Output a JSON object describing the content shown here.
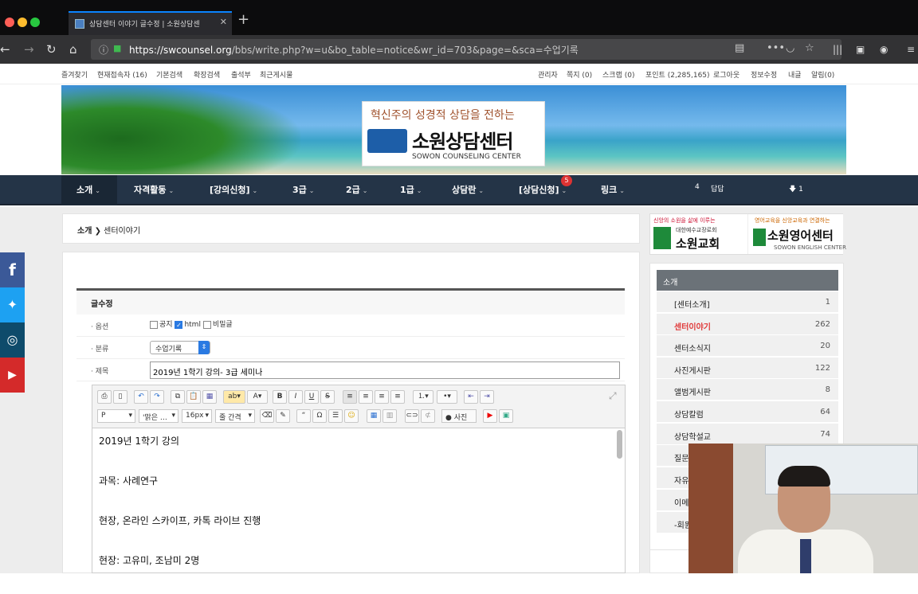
{
  "browser": {
    "tab_title": "상담센터 이야기 글수정 | 소원상담센",
    "url_host": "https://swcounsel.org",
    "url_path": "/bbs/write.php?w=u&bo_table=notice&wr_id=703&page=&sca=수업기록"
  },
  "toplinks": {
    "left": [
      "즐겨찾기",
      "현재접속자 (16)",
      "기본검색",
      "확장검색",
      "출석부",
      "최근게시물"
    ],
    "right": [
      "관리자",
      "쪽지 (0)",
      "스크랩 (0)",
      "포인트 (2,285,165)",
      "로그아웃",
      "정보수정",
      "내글",
      "알림(0)"
    ]
  },
  "banner": {
    "slogan": "혁신주의 성경적 상담을 전하는",
    "name": "소원상담센터",
    "name_en": "SOWON COUNSELING CENTER"
  },
  "menu": {
    "items": [
      "소개",
      "자격활동",
      "[강의신청]",
      "3급",
      "2급",
      "1급",
      "상담란",
      "[상담신청]",
      "링크"
    ],
    "badge": "5",
    "extra_count": "4",
    "extra_label": "답답",
    "extra_right": "1"
  },
  "breadcrumb": {
    "parent": "소개",
    "current": "센터이야기"
  },
  "form": {
    "title": "글수정",
    "option_label": "· 옵션",
    "options": [
      "공지",
      "html",
      "비밀글"
    ],
    "category_label": "· 분류",
    "category_value": "수업기록",
    "subject_label": "· 제목",
    "subject_value": "2019년 1학기 강의- 3급 세미나"
  },
  "editor": {
    "format": "P",
    "font": "'맑은 …",
    "size": "16px",
    "line_height": "줄 간격",
    "photo": "사진",
    "lines": [
      "2019년 1학기 강의",
      "과목: 사례연구",
      "현장, 온라인 스카이프, 카톡 라이브 진행",
      "현장: 고유미, 조남미 2명"
    ]
  },
  "ads": {
    "ad1_top": "신앙의 소원을 삶에 이루는",
    "ad1_sub": "대한예수교장로회",
    "ad1_name": "소원교회",
    "ad2_top": "영어교육을 신앙교육과 연결하는",
    "ad2_name": "소원영어센터",
    "ad2_en": "SOWON ENGLISH CENTER"
  },
  "sidebar": {
    "head": "소개",
    "items": [
      {
        "label": "[센터소개]",
        "count": "1"
      },
      {
        "label": "센터이야기",
        "count": "262"
      },
      {
        "label": "센터소식지",
        "count": "20"
      },
      {
        "label": "사진게시판",
        "count": "122"
      },
      {
        "label": "앨범게시판",
        "count": "8"
      },
      {
        "label": "상담칼럼",
        "count": "64"
      },
      {
        "label": "상담학설교",
        "count": "74"
      },
      {
        "label": "질문",
        "count": ""
      },
      {
        "label": "자유",
        "count": ""
      },
      {
        "label": "이메",
        "count": ""
      },
      {
        "label": "-회원",
        "count": ""
      }
    ]
  },
  "colors": {
    "menu_bg": "#243447",
    "accent_red": "#e03a3a",
    "sidebar_head": "#6b7278"
  }
}
